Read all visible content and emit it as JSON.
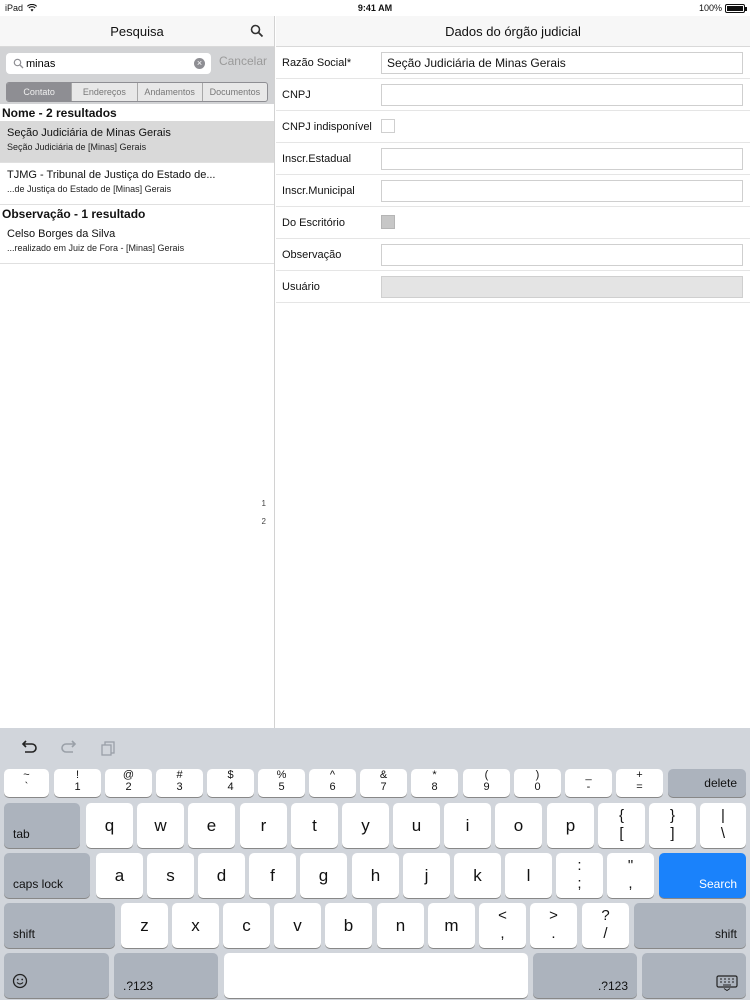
{
  "status_bar": {
    "device": "iPad",
    "time": "9:41 AM",
    "battery": "100%"
  },
  "left_panel": {
    "title": "Pesquisa",
    "search": {
      "value": "minas",
      "cancel_label": "Cancelar"
    },
    "tabs": [
      "Contato",
      "Endereços",
      "Andamentos",
      "Documentos"
    ],
    "active_tab": "Contato",
    "sections": [
      {
        "title": "Nome - 2 resultados",
        "results": [
          {
            "title": "Seção Judiciária de Minas Gerais",
            "subtitle": "Seção Judiciária de [Minas] Gerais",
            "selected": true
          },
          {
            "title": "TJMG - Tribunal de Justiça do Estado de...",
            "subtitle": "...de Justiça do Estado de [Minas] Gerais",
            "selected": false
          }
        ]
      },
      {
        "title": "Observação - 1 resultado",
        "results": [
          {
            "title": "Celso Borges da Silva",
            "subtitle": "...realizado em Juiz de Fora - [Minas] Gerais",
            "selected": false
          }
        ]
      }
    ],
    "index": [
      "1",
      "2"
    ]
  },
  "right_panel": {
    "title": "Dados do órgão judicial",
    "fields": {
      "razao_social": {
        "label": "Razão Social*",
        "value": "Seção Judiciária de Minas Gerais"
      },
      "cnpj": {
        "label": "CNPJ",
        "value": ""
      },
      "cnpj_indisponivel": {
        "label": "CNPJ indisponível",
        "checked": false
      },
      "inscr_estadual": {
        "label": "Inscr.Estadual",
        "value": ""
      },
      "inscr_municipal": {
        "label": "Inscr.Municipal",
        "value": ""
      },
      "do_escritorio": {
        "label": "Do Escritório",
        "checked": false
      },
      "observacao": {
        "label": "Observação",
        "value": ""
      },
      "usuario": {
        "label": "Usuário",
        "value": ""
      }
    }
  },
  "keyboard": {
    "toolbar": [
      "undo-icon",
      "redo-icon",
      "paste-icon"
    ],
    "row1": [
      [
        "~",
        "`"
      ],
      [
        "!",
        "1"
      ],
      [
        "@",
        "2"
      ],
      [
        "#",
        "3"
      ],
      [
        "$",
        "4"
      ],
      [
        "%",
        "5"
      ],
      [
        "^",
        "6"
      ],
      [
        "&",
        "7"
      ],
      [
        "*",
        "8"
      ],
      [
        "(",
        "9"
      ],
      [
        ")",
        "0"
      ],
      [
        "_",
        "-"
      ],
      [
        "+",
        "="
      ]
    ],
    "delete_label": "delete",
    "tab_label": "tab",
    "row2": [
      "q",
      "w",
      "e",
      "r",
      "t",
      "y",
      "u",
      "i",
      "o",
      "p"
    ],
    "row2_syms": [
      [
        "{",
        "["
      ],
      [
        "}",
        "]"
      ],
      [
        "|",
        "\\"
      ]
    ],
    "caps_label": "caps lock",
    "row3": [
      "a",
      "s",
      "d",
      "f",
      "g",
      "h",
      "j",
      "k",
      "l"
    ],
    "row3_syms": [
      [
        ":",
        ";"
      ],
      [
        "\"",
        ","
      ]
    ],
    "search_label": "Search",
    "shift_label": "shift",
    "row4": [
      "z",
      "x",
      "c",
      "v",
      "b",
      "n",
      "m"
    ],
    "row4_syms": [
      [
        "<",
        ","
      ],
      [
        ">",
        "."
      ],
      [
        "?",
        "/"
      ]
    ],
    "numbers_label": ".?123",
    "accent_color": "#1a82fb"
  }
}
